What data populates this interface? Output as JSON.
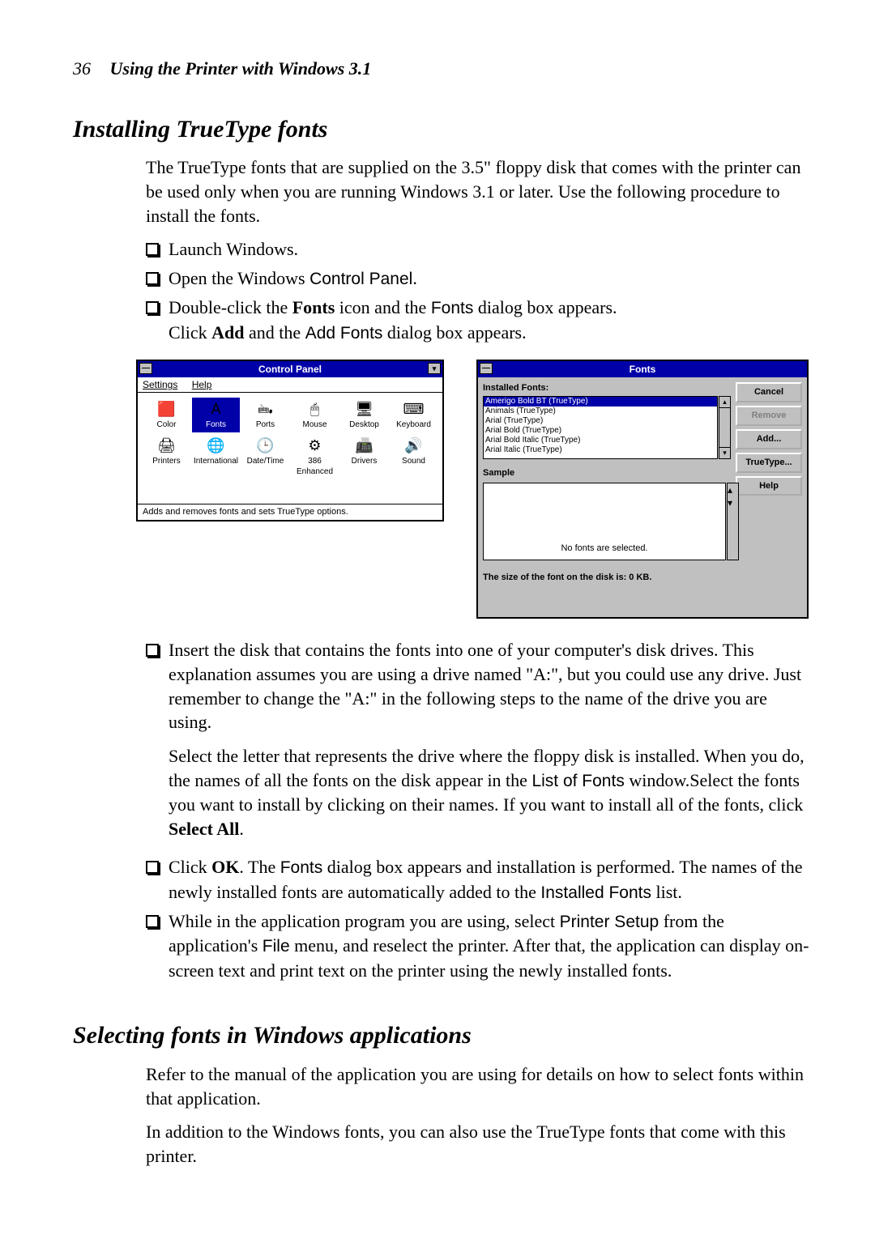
{
  "header": {
    "page_number": "36",
    "chapter_title": "Using the Printer with Windows 3.1"
  },
  "section1": {
    "title": "Installing TrueType fonts",
    "intro": "The TrueType fonts that are supplied on the 3.5\" floppy disk that comes with the printer can be used only when you are running Windows 3.1 or later. Use the following procedure to install the fonts.",
    "b1": "Launch Windows.",
    "b2_pre": "Open the Windows ",
    "b2_cp": "Control Panel",
    "b2_post": ".",
    "b3_a": "Double-click the ",
    "b3_fonts_bold": "Fonts",
    "b3_b": " icon and the ",
    "b3_fonts_sans": "Fonts",
    "b3_c": " dialog box appears.",
    "b3_line2_a": "Click ",
    "b3_add_bold": "Add",
    "b3_line2_b": " and the ",
    "b3_addfonts_sans": "Add Fonts",
    "b3_line2_c": " dialog box appears.",
    "b4_p1": "Insert the disk that contains the fonts into one of your computer's disk drives. This explanation assumes you are using a drive named \"A:\", but you could use any drive. Just remember to change the \"A:\" in the following steps to the name of the drive you are using.",
    "b4_p2_a": "Select the letter that represents the drive where the floppy disk is installed. When you do, the names of all the fonts on the disk appear in the ",
    "b4_p2_list_sans": "List of Fonts",
    "b4_p2_b": " window.Select the fonts you want to install by clicking on their names. If you want to install all of the fonts, click ",
    "b4_p2_selectall": "Select All",
    "b4_p2_c": ".",
    "b5_a": "Click ",
    "b5_ok": "OK",
    "b5_b": ". The ",
    "b5_fonts_sans": "Fonts",
    "b5_c": " dialog box appears and installation is performed. The names of the newly installed fonts are automatically added to the ",
    "b5_inst_sans": "Installed Fonts",
    "b5_d": " list.",
    "b6_a": "While in the application program you are using, select ",
    "b6_ps_sans": "Printer Setup",
    "b6_b": " from the application's ",
    "b6_file_sans": "File",
    "b6_c": " menu, and reselect the printer. After that, the application can display on-screen text and print text on the printer using the newly installed fonts."
  },
  "section2": {
    "title": "Selecting fonts in Windows applications",
    "p1": "Refer to the manual of the application you are using for details on how to select fonts within that application.",
    "p2": "In addition to the Windows fonts, you can also use the TrueType fonts that come with this printer."
  },
  "control_panel": {
    "title": "Control Panel",
    "menu_settings": "Settings",
    "menu_help": "Help",
    "items": [
      {
        "label": "Color",
        "icon": "🟥"
      },
      {
        "label": "Fonts",
        "icon": "A",
        "selected": true
      },
      {
        "label": "Ports",
        "icon": "🖦"
      },
      {
        "label": "Mouse",
        "icon": "🖱"
      },
      {
        "label": "Desktop",
        "icon": "🖥"
      },
      {
        "label": "Keyboard",
        "icon": "⌨"
      },
      {
        "label": "Printers",
        "icon": "🖨"
      },
      {
        "label": "International",
        "icon": "🌐"
      },
      {
        "label": "Date/Time",
        "icon": "🕒"
      },
      {
        "label": "386 Enhanced",
        "icon": "⚙"
      },
      {
        "label": "Drivers",
        "icon": "📠"
      },
      {
        "label": "Sound",
        "icon": "🔊"
      }
    ],
    "status": "Adds and removes fonts and sets TrueType options."
  },
  "fonts_dialog": {
    "title": "Fonts",
    "installed_label": "Installed Fonts:",
    "fonts": [
      "Amerigo Bold BT (TrueType)",
      "Animals (TrueType)",
      "Arial (TrueType)",
      "Arial Bold (TrueType)",
      "Arial Bold Italic (TrueType)",
      "Arial Italic (TrueType)"
    ],
    "sample_label": "Sample",
    "sample_text": "No fonts are selected.",
    "size_line": "The size of the font on the disk is:  0 KB.",
    "buttons": {
      "cancel": "Cancel",
      "remove": "Remove",
      "add": "Add...",
      "truetype": "TrueType...",
      "help": "Help"
    }
  }
}
